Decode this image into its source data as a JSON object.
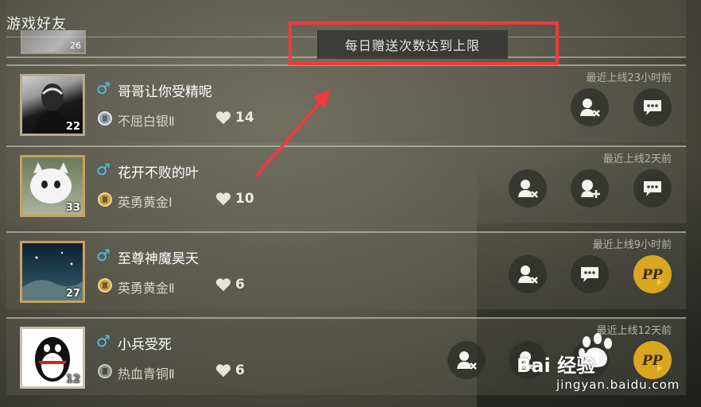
{
  "header": {
    "title": "游戏好友"
  },
  "partial_row": {
    "level": "26"
  },
  "toast": {
    "message": "每日赠送次数达到上限"
  },
  "friends": [
    {
      "name": "哥哥让你受精呢",
      "gender": "♂",
      "rank": "不屈白银Ⅱ",
      "likes": "14",
      "level": "22",
      "online": "最近上线23小时前",
      "buttons": [
        "remove-friend",
        "chat"
      ]
    },
    {
      "name": "花开不败的叶",
      "gender": "♂",
      "rank": "英勇黄金Ⅰ",
      "likes": "10",
      "level": "33",
      "online": "最近上线2天前",
      "buttons": [
        "remove-friend",
        "add-friend",
        "chat"
      ]
    },
    {
      "name": "至尊神魔昊天",
      "gender": "♂",
      "rank": "英勇黄金Ⅱ",
      "likes": "6",
      "level": "27",
      "online": "最近上线9小时前",
      "buttons": [
        "remove-friend",
        "chat",
        "send-gift"
      ]
    },
    {
      "name": "小兵受死",
      "gender": "♂",
      "rank": "热血青铜Ⅱ",
      "likes": "6",
      "level": "12",
      "online": "最近上线12天前",
      "buttons": [
        "remove-friend",
        "add-friend",
        "chat",
        "send-gift"
      ]
    }
  ],
  "watermark": {
    "brand": "Bai 经验",
    "url": "jingyan.baidu.com"
  },
  "colors": {
    "highlight": "#ef3b3b",
    "gender": "#4fc0e8",
    "gift": "#d9a620"
  }
}
